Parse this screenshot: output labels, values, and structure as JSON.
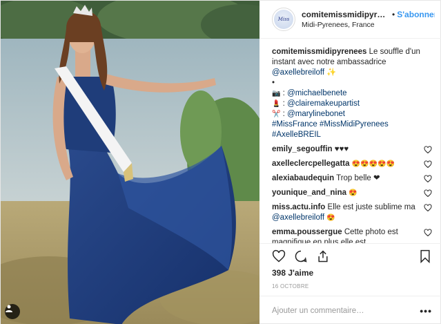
{
  "header": {
    "username": "comitemissmidipyrenees",
    "separator": "•",
    "follow_label": "S'abonner",
    "location": "Midi-Pyrenees, France",
    "avatar_text": "Miss"
  },
  "caption": {
    "username": "comitemissmidipyrenees",
    "text": "Le souffle d'un instant avec notre ambassadrice",
    "mention": "@axellebreiloff",
    "sparkle": "✨",
    "bullet": "•",
    "credits": [
      {
        "icon": "📷",
        "separator": ":",
        "handle": "@michaelbenete"
      },
      {
        "icon": "💄",
        "separator": ":",
        "handle": "@clairemakeupartist"
      },
      {
        "icon": "✂️",
        "separator": ":",
        "handle": "@marylinebonet"
      }
    ],
    "hashtags_line1": "#MissFrance #MissMidiPyrenees",
    "hashtags_line2": "#AxelleBREIL"
  },
  "comments": [
    {
      "user": "emily_segouffin",
      "text": "♥♥♥"
    },
    {
      "user": "axelleclercpellegatta",
      "text": "😍😍😍😍😍"
    },
    {
      "user": "alexiabaudequin",
      "text": "Trop belle ❤"
    },
    {
      "user": "younique_and_nina",
      "text": "😍"
    },
    {
      "user": "miss.actu.info",
      "text": "Elle est juste sublime ma",
      "mention": "@axellebreiloff",
      "suffix": "😍"
    },
    {
      "user": "emma.poussergue",
      "text": "Cette photo est magnifique en plus elle est resplendissante",
      "suffix": "😍💕"
    }
  ],
  "likes": "398 J'aime",
  "date": "16 octobre",
  "add_comment": {
    "placeholder": "Ajouter un commentaire…",
    "more": "•••"
  },
  "colors": {
    "link": "#003569",
    "follow": "#3897f0",
    "dress": "#1f3d7a"
  }
}
